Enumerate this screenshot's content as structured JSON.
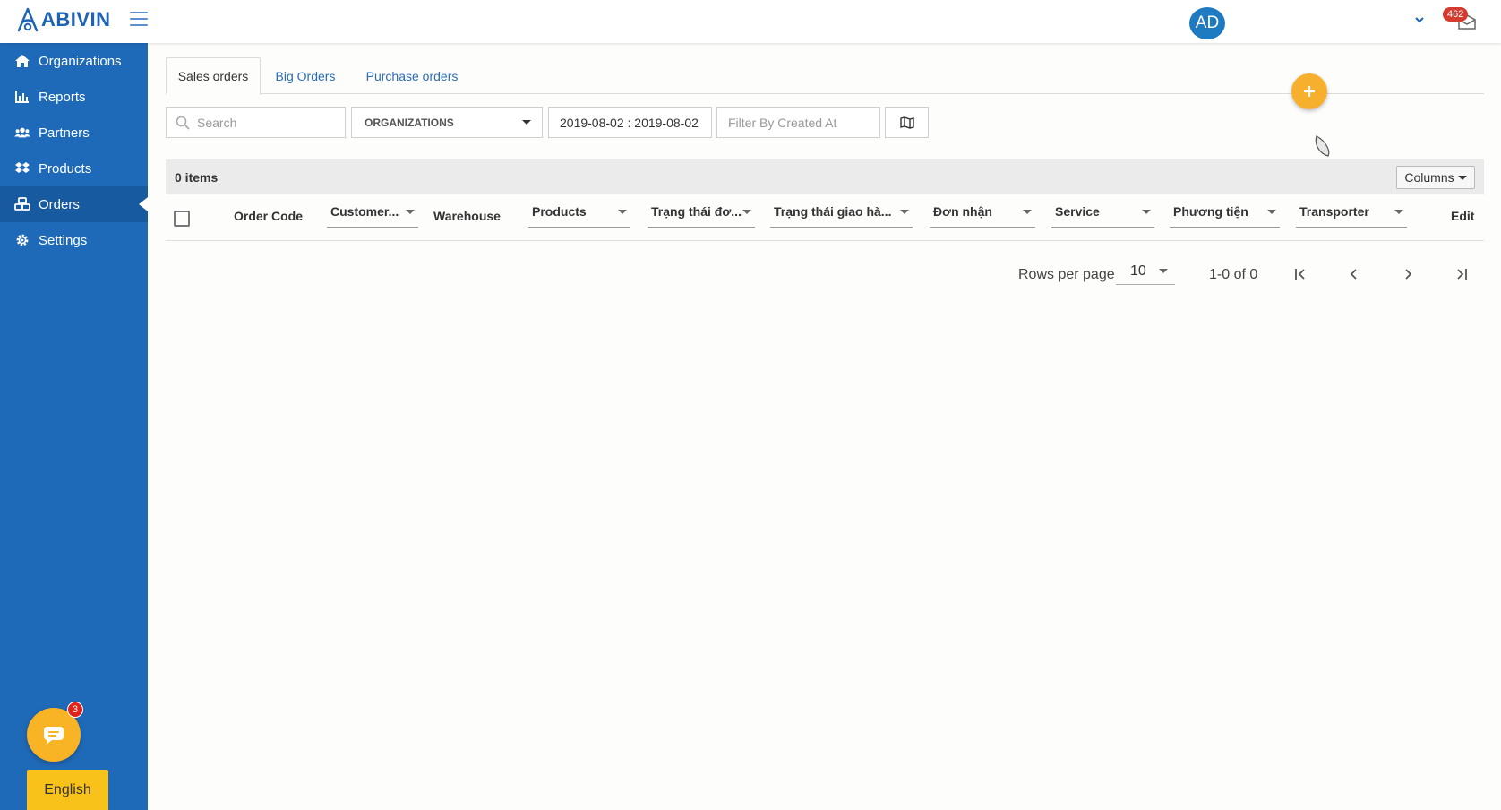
{
  "app": {
    "brand": "ABIVIN",
    "user_initials": "AD",
    "mail_count": "462",
    "brand_color": "#1f6ab8",
    "accent_color": "#f9b425"
  },
  "sidebar": {
    "items": [
      {
        "label": "Organizations",
        "icon": "home-icon"
      },
      {
        "label": "Reports",
        "icon": "bar-chart-icon"
      },
      {
        "label": "Partners",
        "icon": "users-icon"
      },
      {
        "label": "Products",
        "icon": "dropbox-icon"
      },
      {
        "label": "Orders",
        "icon": "cubes-icon",
        "active": true
      },
      {
        "label": "Settings",
        "icon": "gear-icon"
      }
    ],
    "chat_badge": "3",
    "language": "English"
  },
  "tabs": [
    {
      "label": "Sales orders",
      "active": true
    },
    {
      "label": "Big Orders"
    },
    {
      "label": "Purchase orders"
    }
  ],
  "filters": {
    "search_placeholder": "Search",
    "organizations": "ORGANIZATIONS",
    "date_range": "2019-08-02 : 2019-08-02",
    "created_at_placeholder": "Filter By Created At"
  },
  "table": {
    "items_count": "0 items",
    "columns_button": "Columns",
    "columns": [
      {
        "label": "Order Code"
      },
      {
        "label": "Customer..."
      },
      {
        "label": "Warehouse"
      },
      {
        "label": "Products"
      },
      {
        "label": "Trạng thái đơ..."
      },
      {
        "label": "Trạng thái giao hà..."
      },
      {
        "label": "Đơn nhận"
      },
      {
        "label": "Service"
      },
      {
        "label": "Phương tiện"
      },
      {
        "label": "Transporter"
      },
      {
        "label": "Edit"
      }
    ]
  },
  "pagination": {
    "rows_per_page_label": "Rows per page",
    "rows_per_page": "10",
    "range": "1-0 of 0"
  }
}
